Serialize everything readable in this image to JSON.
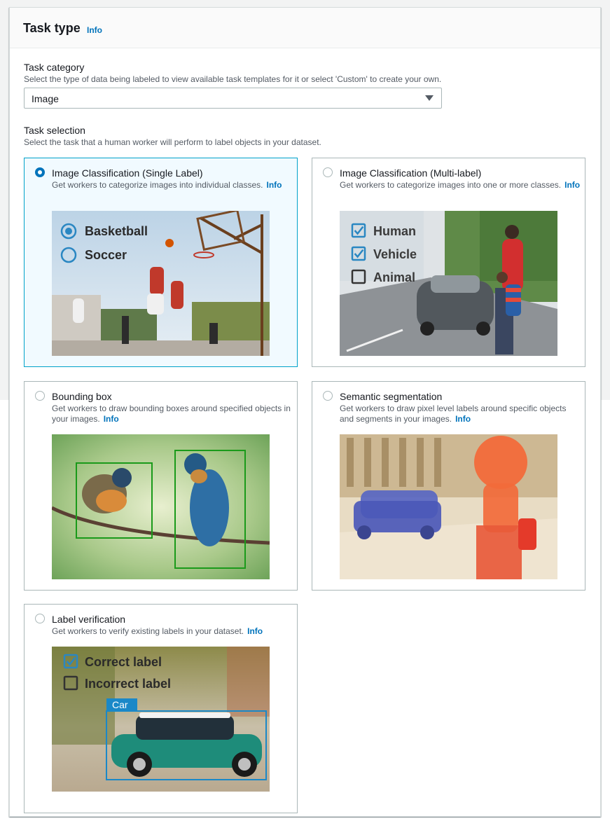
{
  "header": {
    "title": "Task type",
    "info": "Info"
  },
  "task_category": {
    "label": "Task category",
    "description": "Select the type of data being labeled to view available task templates for it or select 'Custom' to create your own.",
    "selected": "Image"
  },
  "task_selection": {
    "label": "Task selection",
    "description": "Select the task that a human worker will perform to label objects in your dataset."
  },
  "cards": [
    {
      "title": "Image Classification (Single Label)",
      "description": "Get workers to categorize images into individual classes.",
      "info": "Info",
      "selected": true,
      "image_labels": [
        "Basketball",
        "Soccer"
      ]
    },
    {
      "title": "Image Classification (Multi-label)",
      "description": "Get workers to categorize images into one or more classes.",
      "info": "Info",
      "selected": false,
      "image_labels": [
        "Human",
        "Vehicle",
        "Animal"
      ]
    },
    {
      "title": "Bounding box",
      "description": "Get workers to draw bounding boxes around specified objects in your images.",
      "info": "Info",
      "selected": false
    },
    {
      "title": "Semantic segmentation",
      "description": "Get workers to draw pixel level labels around specific objects and segments in your images.",
      "info": "Info",
      "selected": false
    },
    {
      "title": "Label verification",
      "description": "Get workers to verify existing labels in your dataset.",
      "info": "Info",
      "selected": false,
      "image_labels": [
        "Correct label",
        "Incorrect label",
        "Car"
      ]
    }
  ],
  "colors": {
    "accent": "#0073bb",
    "selected_border": "#00a1c9",
    "selected_bg": "#f1faff",
    "bbox_green": "#1a9a1a",
    "label_blue": "#1a88c8"
  }
}
